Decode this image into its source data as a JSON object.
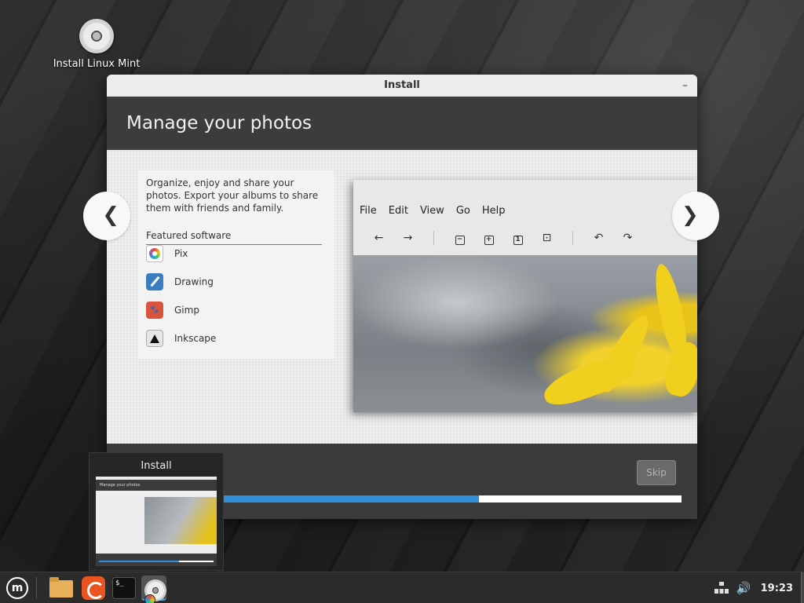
{
  "desktop": {
    "icon_label": "Install Linux Mint",
    "icon_name": "disc-icon"
  },
  "window": {
    "title": "Install",
    "minimize_glyph": "–",
    "header": "Manage your photos",
    "slide": {
      "description": "Organize, enjoy and share your photos. Export your albums to share them with friends and family.",
      "featured_title": "Featured software",
      "apps": [
        {
          "name": "Pix",
          "icon": "pix-icon"
        },
        {
          "name": "Drawing",
          "icon": "drawing-icon"
        },
        {
          "name": "Gimp",
          "icon": "gimp-icon"
        },
        {
          "name": "Inkscape",
          "icon": "inkscape-icon"
        }
      ],
      "prev_glyph": "❮",
      "next_glyph": "❯",
      "screenshot_menu": [
        "File",
        "Edit",
        "View",
        "Go",
        "Help"
      ],
      "screenshot_toolbar": [
        "←",
        "→",
        "−",
        "+",
        "1",
        "⊡",
        "↶",
        "↷"
      ]
    },
    "skip_label": "Skip",
    "progress": 0.64
  },
  "thumbnail": {
    "title": "Install",
    "mini_header": "Manage your photos"
  },
  "panel": {
    "menu_glyph": "m",
    "terminal_glyph": "$_",
    "clock": "19:23",
    "volume_glyph": "🔊"
  },
  "colors": {
    "accent": "#2f8fdb",
    "header_bg": "#3c3c3c",
    "titlebar_bg": "#ececec"
  }
}
